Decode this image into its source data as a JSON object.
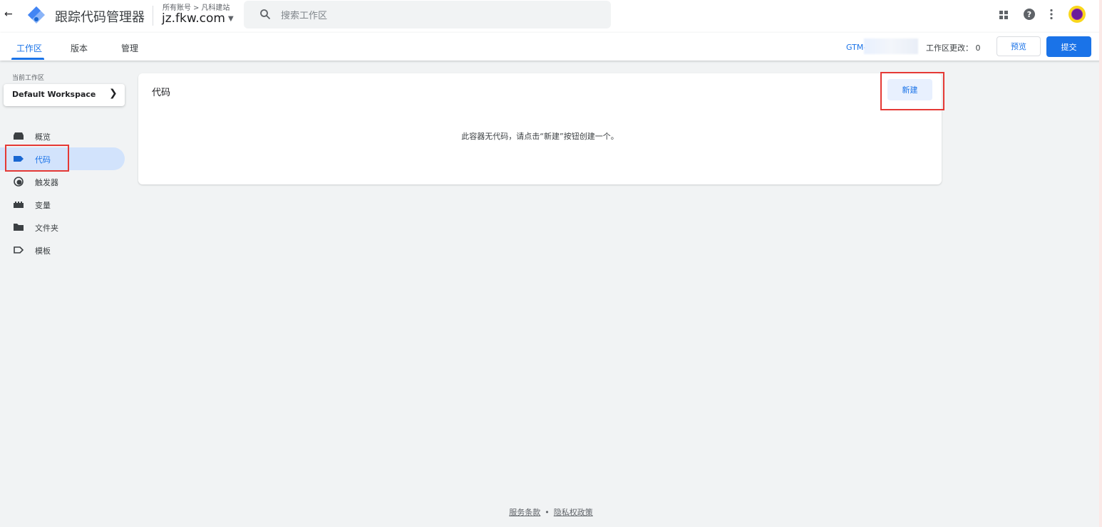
{
  "topbar": {
    "back_icon": "arrow-back-icon",
    "app_title": "跟踪代码管理器",
    "breadcrumb": {
      "account": "所有账号",
      "separator": ">",
      "site": "凡科建站"
    },
    "container_name": "jz.fkw.com",
    "search": {
      "placeholder": "搜索工作区",
      "value": ""
    },
    "colors": {
      "brand": "#1a73e8",
      "avatar_bg": "#f9d71c"
    }
  },
  "subbar": {
    "tabs": [
      {
        "label": "工作区",
        "active": true
      },
      {
        "label": "版本",
        "active": false
      },
      {
        "label": "管理",
        "active": false
      }
    ],
    "gtm_id": "GTM-",
    "workspace_changes": "工作区更改：  0",
    "preview_label": "预览",
    "submit_label": "提交"
  },
  "sidebar": {
    "current_workspace_label": "当前工作区",
    "workspace_name": "Default Workspace",
    "items": [
      {
        "label": "概览",
        "icon": "overview-icon",
        "active": false
      },
      {
        "label": "代码",
        "icon": "tag-icon",
        "active": true
      },
      {
        "label": "触发器",
        "icon": "trigger-icon",
        "active": false
      },
      {
        "label": "变量",
        "icon": "variable-icon",
        "active": false
      },
      {
        "label": "文件夹",
        "icon": "folder-icon",
        "active": false
      },
      {
        "label": "模板",
        "icon": "template-icon",
        "active": false
      }
    ]
  },
  "main": {
    "card_title": "代码",
    "new_button_label": "新建",
    "empty_message": "此容器无代码，请点击“新建”按钮创建一个。"
  },
  "footer": {
    "terms": "服务条款",
    "separator": "•",
    "privacy": "隐私权政策"
  }
}
